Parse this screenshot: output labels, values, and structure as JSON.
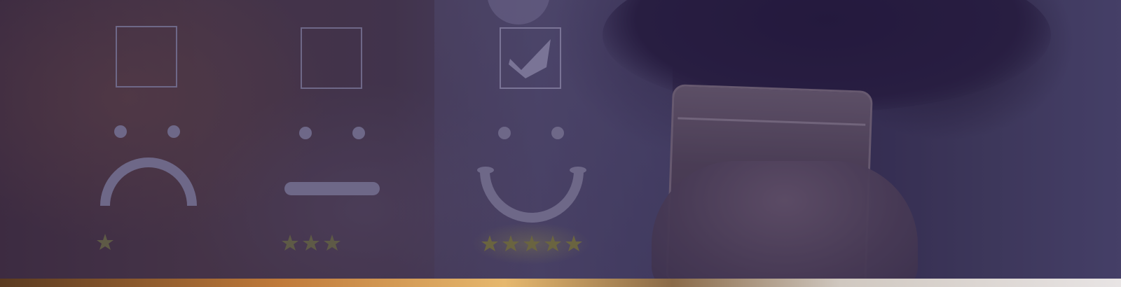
{
  "scene": {
    "description_icons": [
      {
        "icon": "unchecked-box-icon",
        "face": "sad-face-icon",
        "stars": 1,
        "checked": false
      },
      {
        "icon": "unchecked-box-icon",
        "face": "neutral-face-icon",
        "stars": 3,
        "checked": false
      },
      {
        "icon": "checked-box-icon",
        "face": "happy-face-icon",
        "stars": 5,
        "checked": true
      }
    ],
    "colors": {
      "overlay_line": "#7a7394",
      "star": "#6a6440",
      "star_glow": "#8a8448"
    }
  }
}
